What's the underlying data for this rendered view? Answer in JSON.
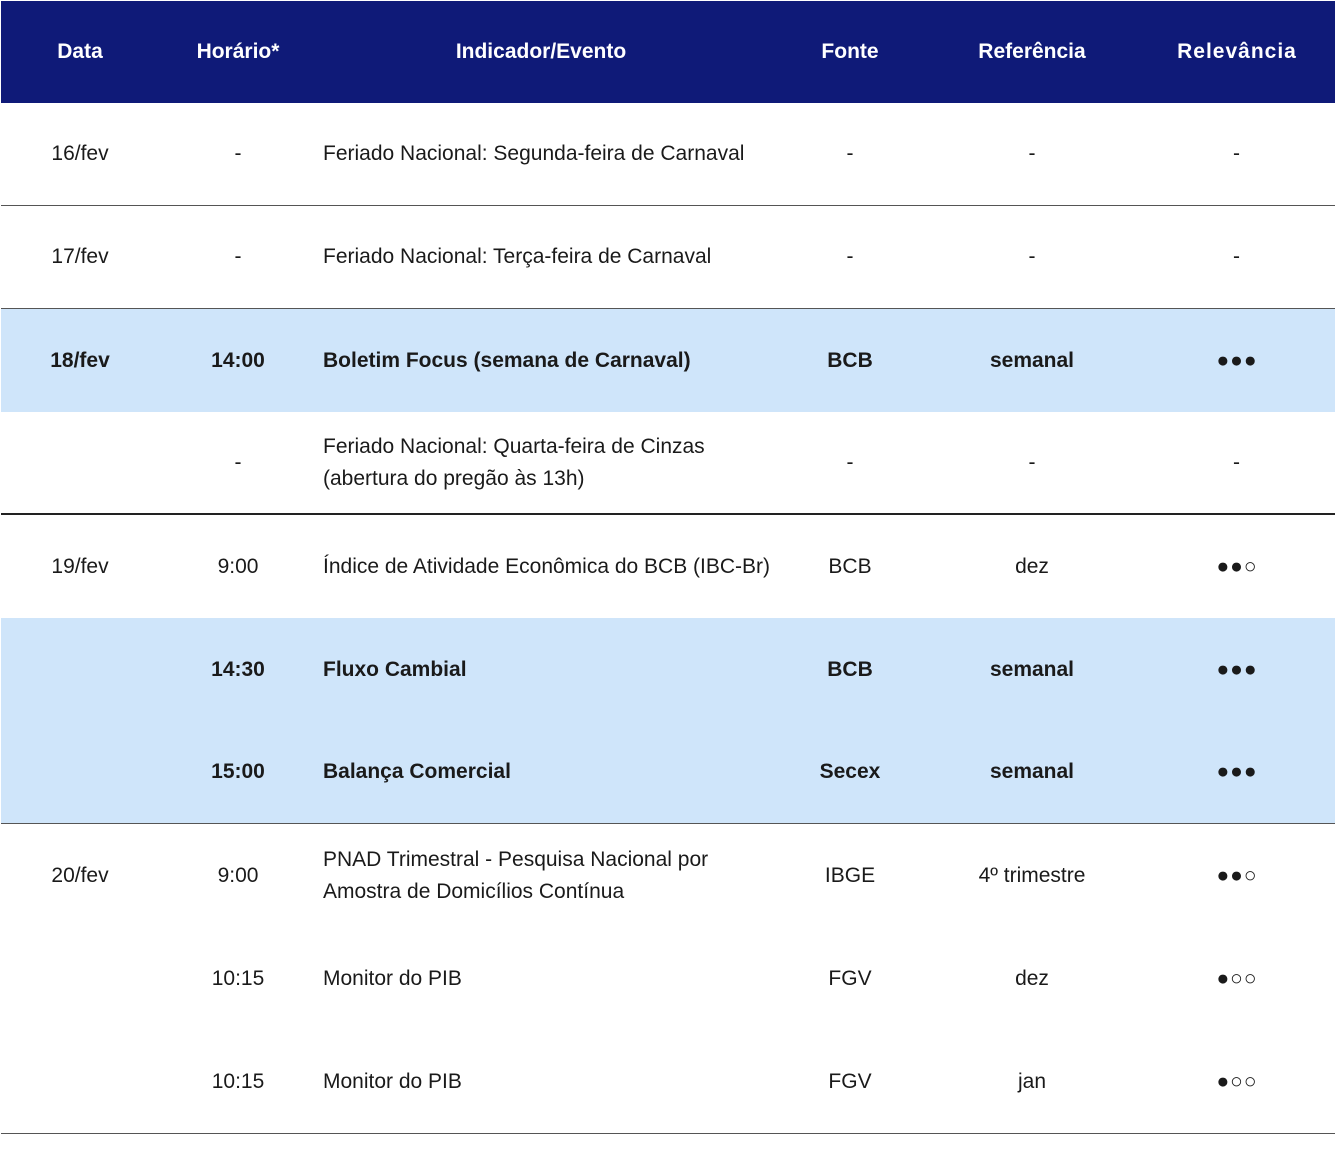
{
  "header": {
    "date": "Data",
    "time": "Horário*",
    "event": "Indicador/Evento",
    "source": "Fonte",
    "reference": "Referência",
    "relevance": "Relevância"
  },
  "rows": [
    {
      "date": "16/fev",
      "time": "-",
      "event": "Feriado Nacional: Segunda-feira de Carnaval",
      "source": "-",
      "reference": "-",
      "relevance": "-"
    },
    {
      "date": "17/fev",
      "time": "-",
      "event": "Feriado Nacional: Terça-feira de Carnaval",
      "source": "-",
      "reference": "-",
      "relevance": "-"
    },
    {
      "date": "18/fev",
      "time": "14:00",
      "event": "Boletim Focus (semana de Carnaval)",
      "source": "BCB",
      "reference": "semanal",
      "relevance": "●●●"
    },
    {
      "date": "",
      "time": "-",
      "event": "Feriado Nacional: Quarta-feira de Cinzas (abertura do pregão às 13h)",
      "source": "-",
      "reference": "-",
      "relevance": "-"
    },
    {
      "date": "19/fev",
      "time": "9:00",
      "event": "Índice de Atividade Econômica do BCB (IBC-Br)",
      "source": "BCB",
      "reference": "dez",
      "relevance": "●●○"
    },
    {
      "date": "",
      "time": "14:30",
      "event": "Fluxo Cambial",
      "source": "BCB",
      "reference": "semanal",
      "relevance": "●●●"
    },
    {
      "date": "",
      "time": "15:00",
      "event": "Balança Comercial",
      "source": "Secex",
      "reference": "semanal",
      "relevance": "●●●"
    },
    {
      "date": "20/fev",
      "time": "9:00",
      "event": "PNAD Trimestral - Pesquisa Nacional por Amostra de Domicílios Contínua",
      "source": "IBGE",
      "reference": "4º trimestre",
      "relevance": "●●○"
    },
    {
      "date": "",
      "time": "10:15",
      "event": "Monitor do PIB",
      "source": "FGV",
      "reference": "dez",
      "relevance": "●○○"
    },
    {
      "date": "",
      "time": "10:15",
      "event": "Monitor do PIB",
      "source": "FGV",
      "reference": "jan",
      "relevance": "●○○"
    }
  ]
}
